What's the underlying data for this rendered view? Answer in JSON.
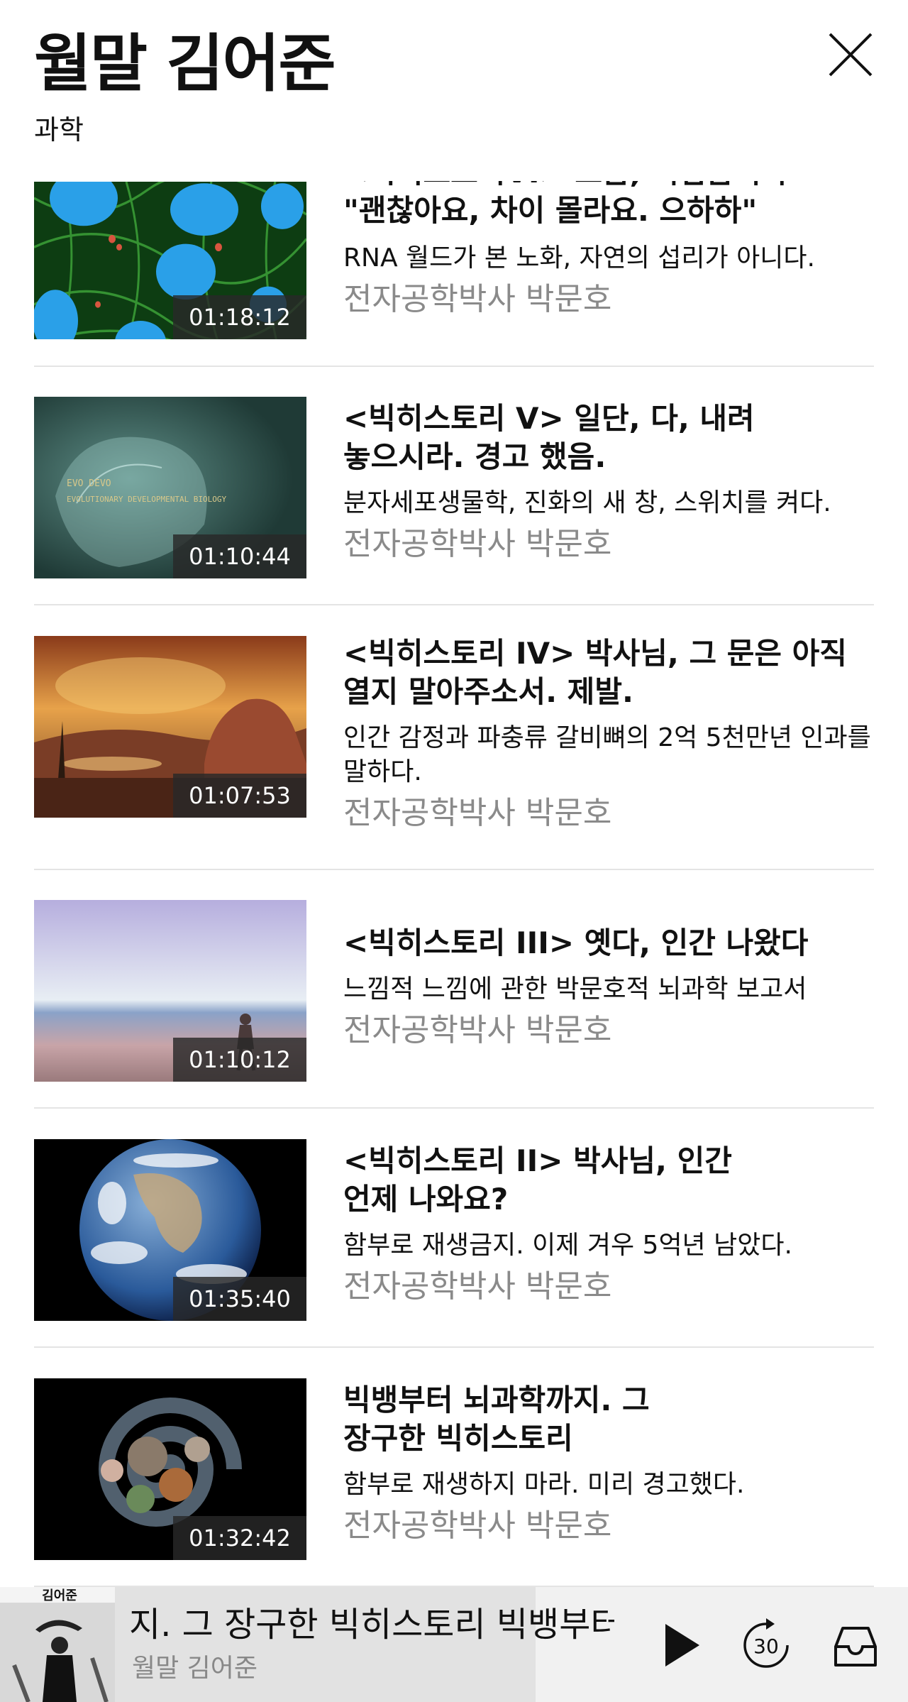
{
  "header": {
    "title": "월말 김어준",
    "category": "과학"
  },
  "episodes": [
    {
      "title_lines": [
        "<빅히스토리VI> 조금, 어렵습니다",
        "\"괜찮아요, 차이 몰라요. 으하하\""
      ],
      "description": "RNA 월드가 본 노화, 자연의 섭리가 아니다.",
      "author": "전자공학박사 박문호",
      "duration": "01:18:12",
      "thumbnail": "cells-microscopy"
    },
    {
      "title_lines": [
        "<빅히스토리 V> 일단, 다, 내려",
        "놓으시라. 경고 했음."
      ],
      "description": "분자세포생물학, 진화의 새 창, 스위치를 켜다.",
      "author": "전자공학박사 박문호",
      "duration": "01:10:44",
      "thumbnail": "evo-devo-jellyfish",
      "thumbnail_text": [
        "EVO DEVO",
        "EVOLUTIONARY DEVELOPMENTAL BIOLOGY"
      ]
    },
    {
      "title_lines": [
        "<빅히스토리 IV> 박사님, 그 문은 아직",
        "열지 말아주소서. 제발."
      ],
      "description": "인간 감정과 파충류 갈비뼈의 2억 5천만년 인과를 말하다.",
      "author": "전자공학박사 박문호",
      "duration": "01:07:53",
      "thumbnail": "dimetrodon-sunset"
    },
    {
      "title_lines": [
        "<빅히스토리 III> 옛다, 인간 나왔다"
      ],
      "description": "느낌적 느낌에 관한 박문호적 뇌과학 보고서",
      "author": "전자공학박사 박문호",
      "duration": "01:10:12",
      "thumbnail": "beach-walker"
    },
    {
      "title_lines": [
        "<빅히스토리 II> 박사님, 인간",
        "언제 나와요?"
      ],
      "description": "함부로 재생금지. 이제 겨우 5억년 남았다.",
      "author": "전자공학박사 박문호",
      "duration": "01:35:40",
      "thumbnail": "earth-globe"
    },
    {
      "title_lines": [
        "빅뱅부터 뇌과학까지. 그",
        "장구한 빅히스토리"
      ],
      "description": "함부로 재생하지 마라. 미리 경고했다.",
      "author": "전자공학박사 박문호",
      "duration": "01:32:42",
      "thumbnail": "cosmic-spiral"
    }
  ],
  "player": {
    "now_playing_title": "지. 그 장구한 빅히스토리    빅뱅부터 뇌과학까지. 그 장구한 빅히스토리",
    "show_name": "월말 김어준",
    "art_label": "김어준",
    "skip_seconds": "30",
    "progress_fraction": 0.59
  },
  "icons": {
    "close": "close-icon",
    "play": "play-icon",
    "skip": "forward-30-icon",
    "inbox": "inbox-icon"
  }
}
